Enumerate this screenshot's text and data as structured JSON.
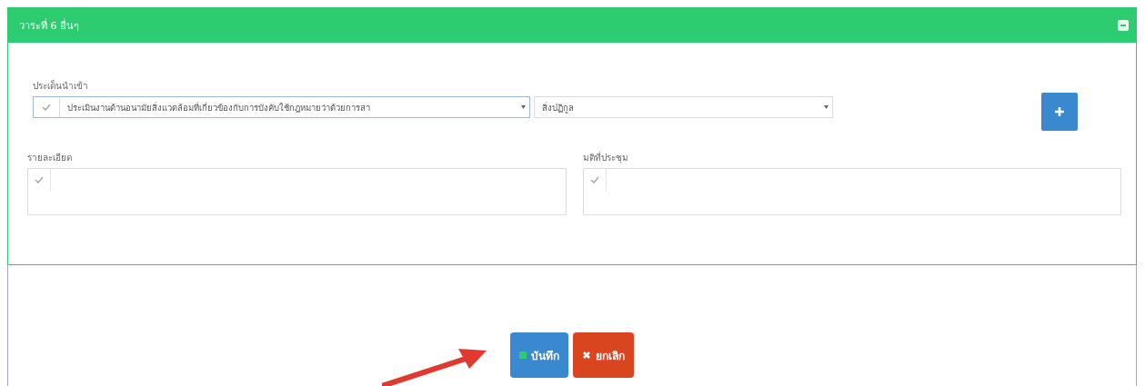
{
  "panel": {
    "title": "วาระที่ 6 อื่นๆ"
  },
  "import_issue": {
    "label": "ประเด็นนำเข้า",
    "select_1": "ประเมินงานด้านอนามัยสิ่งแวดล้อมที่เกี่ยวข้องกับการบังคับใช้กฎหมายว่าด้วยการสา",
    "select_2": "สิ่งปฏิกูล"
  },
  "fields": [
    {
      "label": "รายละเอียด"
    },
    {
      "label": "มติที่ประชุม"
    }
  ],
  "buttons": [
    {
      "kind": "save",
      "label": "บันทึก"
    },
    {
      "kind": "cancel",
      "label": "ยกเลิก"
    }
  ]
}
